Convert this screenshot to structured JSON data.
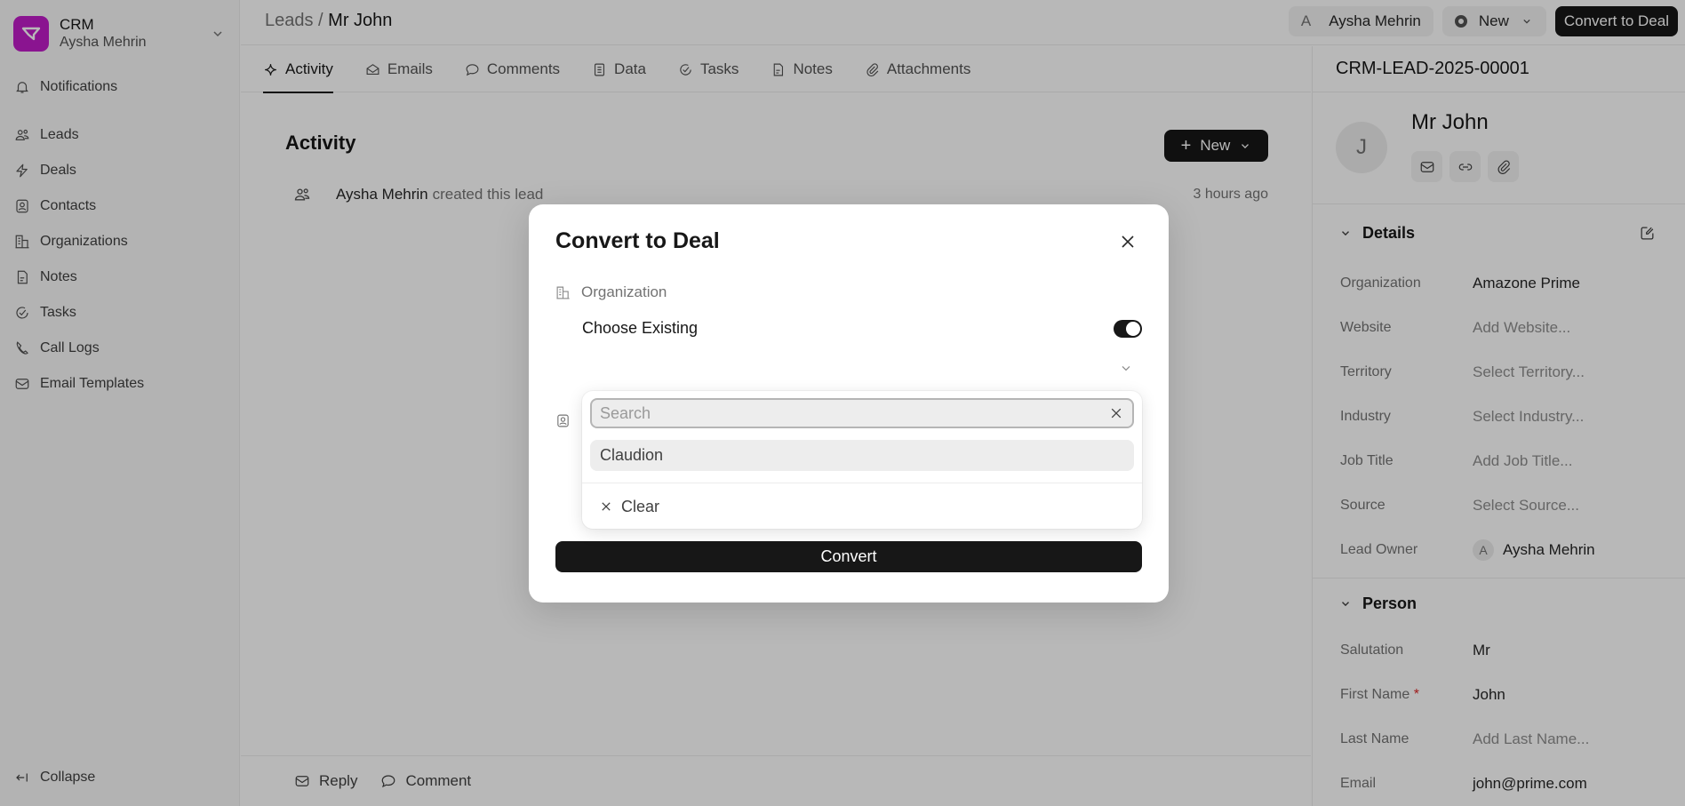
{
  "sidebar": {
    "brand_title": "CRM",
    "brand_user": "Aysha Mehrin",
    "notifications_label": "Notifications",
    "items": [
      {
        "label": "Leads",
        "icon": "users-icon"
      },
      {
        "label": "Deals",
        "icon": "lightning-icon"
      },
      {
        "label": "Contacts",
        "icon": "contact-card-icon"
      },
      {
        "label": "Organizations",
        "icon": "building-icon"
      },
      {
        "label": "Notes",
        "icon": "note-icon"
      },
      {
        "label": "Tasks",
        "icon": "check-circle-icon"
      },
      {
        "label": "Call Logs",
        "icon": "phone-icon"
      },
      {
        "label": "Email Templates",
        "icon": "mail-icon"
      }
    ],
    "collapse_label": "Collapse"
  },
  "header": {
    "breadcrumb_parent": "Leads",
    "breadcrumb_sep": " / ",
    "breadcrumb_current": "Mr John",
    "owner_initial": "A",
    "owner_name": "Aysha Mehrin",
    "status_label": "New",
    "convert_label": "Convert to Deal"
  },
  "tabs": [
    {
      "label": "Activity",
      "icon": "sparkle-icon",
      "active": true
    },
    {
      "label": "Emails",
      "icon": "mail-open-icon"
    },
    {
      "label": "Comments",
      "icon": "comment-icon"
    },
    {
      "label": "Data",
      "icon": "list-icon"
    },
    {
      "label": "Tasks",
      "icon": "check-circle-icon"
    },
    {
      "label": "Notes",
      "icon": "note-icon"
    },
    {
      "label": "Attachments",
      "icon": "paperclip-icon"
    }
  ],
  "activity": {
    "title": "Activity",
    "new_label": "New",
    "entries": [
      {
        "who": "Aysha Mehrin",
        "text": "created this lead",
        "time": "3 hours ago"
      }
    ]
  },
  "footer": {
    "reply_label": "Reply",
    "comment_label": "Comment"
  },
  "panel": {
    "lead_id": "CRM-LEAD-2025-00001",
    "avatar_initial": "J",
    "name": "Mr John",
    "details_title": "Details",
    "details": [
      {
        "label": "Organization",
        "value": "Amazone Prime",
        "placeholder": false
      },
      {
        "label": "Website",
        "value": "Add Website...",
        "placeholder": true
      },
      {
        "label": "Territory",
        "value": "Select Territory...",
        "placeholder": true
      },
      {
        "label": "Industry",
        "value": "Select Industry...",
        "placeholder": true
      },
      {
        "label": "Job Title",
        "value": "Add Job Title...",
        "placeholder": true
      },
      {
        "label": "Source",
        "value": "Select Source...",
        "placeholder": true
      },
      {
        "label": "Lead Owner",
        "value": "Aysha Mehrin",
        "avatar": "A",
        "placeholder": false
      }
    ],
    "person_title": "Person",
    "person": [
      {
        "label": "Salutation",
        "value": "Mr",
        "placeholder": false
      },
      {
        "label": "First Name",
        "required": true,
        "value": "John",
        "placeholder": false
      },
      {
        "label": "Last Name",
        "value": "Add Last Name...",
        "placeholder": true
      },
      {
        "label": "Email",
        "value": "john@prime.com",
        "placeholder": false
      }
    ]
  },
  "modal": {
    "title": "Convert to Deal",
    "org_section_label": "Organization",
    "choose_existing_label": "Choose Existing",
    "choose_existing_on": true,
    "convert_label": "Convert",
    "dropdown": {
      "search_value": "",
      "search_placeholder": "Search",
      "options": [
        "Claudion"
      ],
      "clear_label": "Clear"
    }
  }
}
